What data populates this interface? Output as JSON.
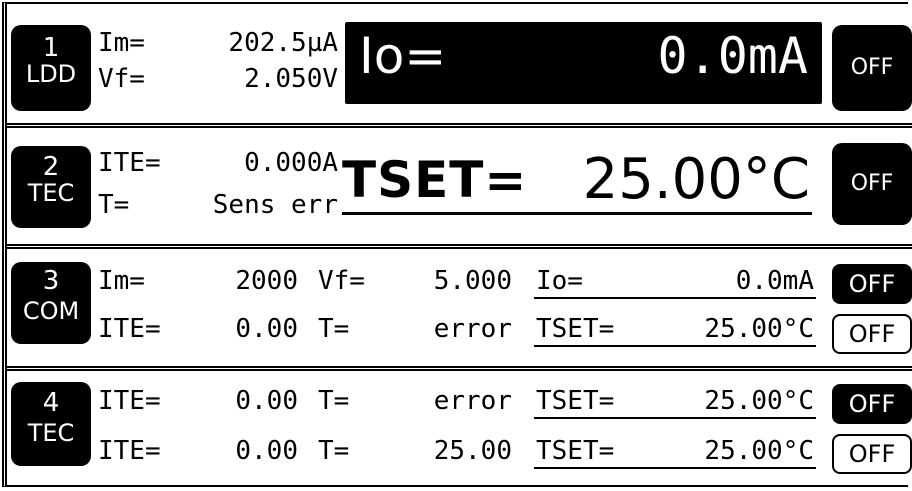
{
  "ch1": {
    "num": "1",
    "name": "LDD",
    "im_label": "Im=",
    "im_value": "202.5µA",
    "vf_label": "Vf=",
    "vf_value": "2.050V",
    "io_label": "Io=",
    "io_value": "0.0mA",
    "off": "OFF"
  },
  "ch2": {
    "num": "2",
    "name": "TEC",
    "ite_label": "ITE=",
    "ite_value": "0.000A",
    "t_label": "T=",
    "t_value": "Sens err",
    "tset_label": "TSET=",
    "tset_value": "25.00°C",
    "off": "OFF"
  },
  "ch3": {
    "num": "3",
    "name": "COM",
    "row1": {
      "a_label": "Im=",
      "a_value": "2000",
      "b_label": "Vf=",
      "b_value": "5.000",
      "c_label": "Io=",
      "c_value": "0.0mA",
      "off": "OFF"
    },
    "row2": {
      "a_label": "ITE=",
      "a_value": "0.00",
      "b_label": "T=",
      "b_value": "error",
      "c_label": "TSET=",
      "c_value": "25.00°C",
      "off": "OFF"
    }
  },
  "ch4": {
    "num": "4",
    "name": "TEC",
    "row1": {
      "a_label": "ITE=",
      "a_value": "0.00",
      "b_label": "T=",
      "b_value": "error",
      "c_label": "TSET=",
      "c_value": "25.00°C",
      "off": "OFF"
    },
    "row2": {
      "a_label": "ITE=",
      "a_value": "0.00",
      "b_label": "T=",
      "b_value": "25.00",
      "c_label": "TSET=",
      "c_value": "25.00°C",
      "off": "OFF"
    }
  }
}
